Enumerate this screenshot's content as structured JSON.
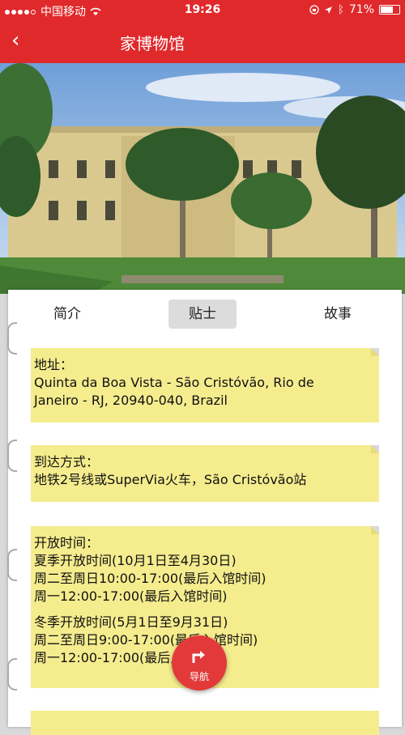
{
  "status": {
    "carrier": "中国移动",
    "time": "19:26",
    "battery": "71%"
  },
  "nav": {
    "back": "‹",
    "title": "家博物馆"
  },
  "tabs": [
    {
      "label": "简介",
      "active": false
    },
    {
      "label": "贴士",
      "active": true
    },
    {
      "label": "故事",
      "active": false
    }
  ],
  "cards": {
    "address": {
      "lines": [
        "地址：",
        "Quinta da Boa Vista - São Cristóvão, Rio de",
        "Janeiro - RJ, 20940-040, Brazil"
      ]
    },
    "transport": {
      "lines": [
        "到达方式：",
        "地铁2号线或SuperVia火车，São Cristóvão站"
      ]
    },
    "hours": {
      "lines": [
        "开放时间：",
        "夏季开放时间(10月1日至4月30日)",
        "周二至周日10:00-17:00(最后入馆时间)",
        "周一12:00-17:00(最后入馆时间)",
        "",
        "冬季开放时间(5月1日至9月31日)",
        "周二至周日9:00-17:00(最后入馆时间)",
        "周一12:00-17:00(最后入馆时间)"
      ]
    }
  },
  "navigate_button": {
    "label": "导航"
  },
  "colors": {
    "brand_red": "#e0292b",
    "note_yellow": "#f5ec8e"
  },
  "icons": {
    "back": "chevron-left-icon",
    "navigate": "turn-right-arrow-icon",
    "wifi": "wifi-icon",
    "location": "location-arrow-icon",
    "bluetooth": "bluetooth-icon",
    "battery": "battery-icon"
  }
}
